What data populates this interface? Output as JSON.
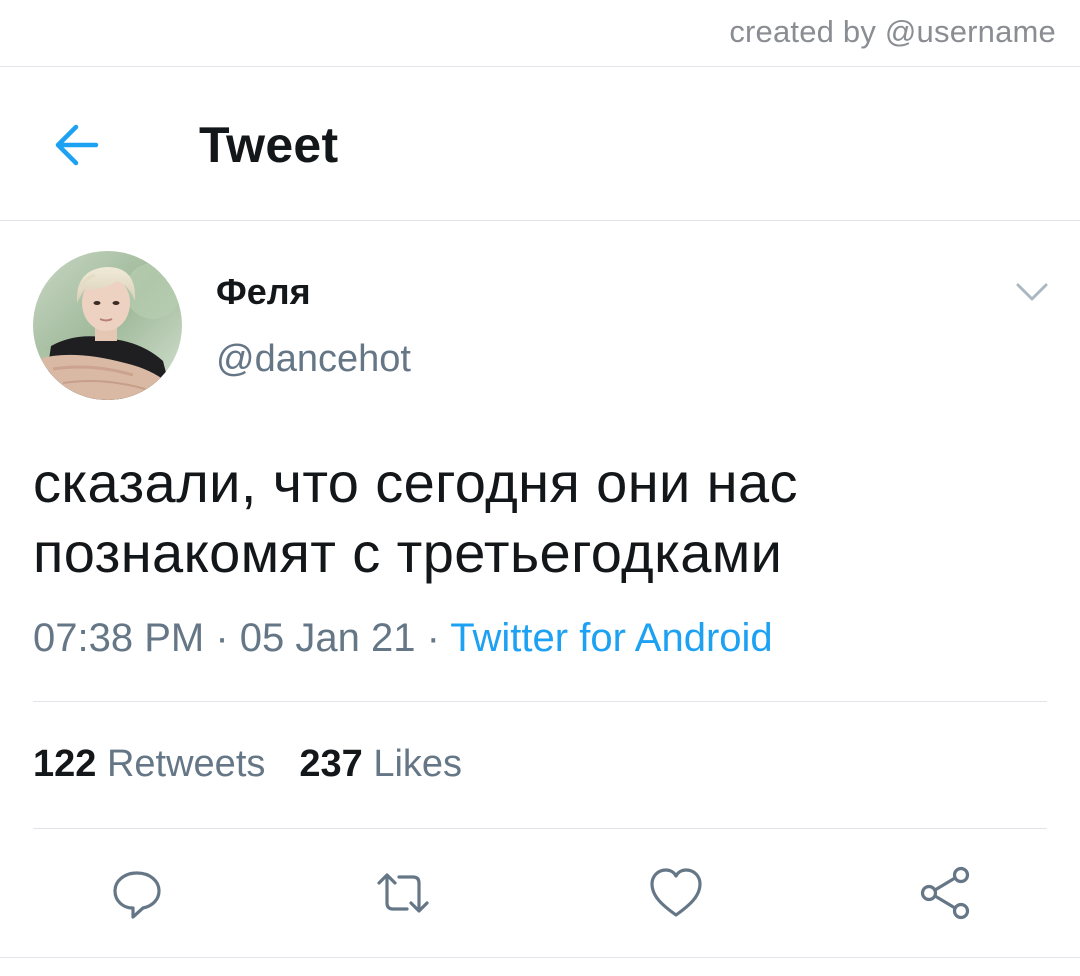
{
  "watermark": "created by @username",
  "header": {
    "back_icon": "arrow-left-icon",
    "title": "Tweet"
  },
  "tweet": {
    "author": {
      "display_name": "Феля",
      "handle": "@dancehot"
    },
    "text_lines": [
      "сказали, что сегодня они нас",
      "познакомят с третьегодками"
    ],
    "time": "07:38 PM",
    "date": "05 Jan 21",
    "separator": " · ",
    "source": "Twitter for Android",
    "retweets_count": "122",
    "retweets_label": "Retweets",
    "likes_count": "237",
    "likes_label": "Likes"
  },
  "actions": {
    "reply_icon": "reply-icon",
    "retweet_icon": "retweet-icon",
    "like_icon": "heart-icon",
    "share_icon": "share-icon"
  },
  "colors": {
    "accent": "#1da1f2",
    "text_primary": "#14171a",
    "text_secondary": "#657786",
    "divider": "#e1e4e8",
    "icon_gray": "#657786"
  }
}
